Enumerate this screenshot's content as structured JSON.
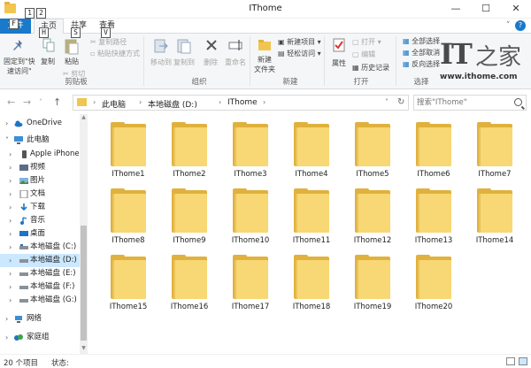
{
  "window": {
    "title": "IThome"
  },
  "keytips": [
    "F",
    "1",
    "2",
    "H",
    "S",
    "V"
  ],
  "tabs": {
    "file": "文件",
    "home": "主页",
    "share": "共享",
    "view": "查看"
  },
  "ribbon": {
    "clipboard": {
      "pin": "固定到\"快",
      "pin2": "速访问\"",
      "copy": "复制",
      "paste": "粘贴",
      "copy_path": "复制路径",
      "paste_shortcut": "粘贴快捷方式",
      "cut": "剪切",
      "label": "剪贴板"
    },
    "organize": {
      "move_to": "移动到",
      "copy_to": "复制到",
      "delete": "删除",
      "rename": "重命名",
      "label": "组织"
    },
    "new": {
      "new_folder": "新建",
      "new_folder2": "文件夹",
      "new_item": "新建项目 ▾",
      "easy_access": "轻松访问 ▾",
      "label": "新建"
    },
    "open": {
      "properties": "属性",
      "open": "打开 ▾",
      "edit": "编辑",
      "history": "历史记录",
      "label": "打开"
    },
    "select": {
      "select_all": "全部选择",
      "select_none": "全部取消",
      "invert": "反向选择",
      "label": "选择"
    }
  },
  "logo": {
    "text": "IT",
    "zh": "之家",
    "url": "www.ithome.com"
  },
  "address": {
    "crumbs": [
      "此电脑",
      "本地磁盘 (D:)",
      "IThome"
    ],
    "search_placeholder": "搜索\"IThome\""
  },
  "nav": {
    "items": [
      {
        "label": "OneDrive",
        "level": 0
      },
      {
        "label": "此电脑",
        "level": 0
      },
      {
        "label": "Apple iPhone",
        "level": 1
      },
      {
        "label": "视频",
        "level": 1
      },
      {
        "label": "图片",
        "level": 1
      },
      {
        "label": "文档",
        "level": 1
      },
      {
        "label": "下载",
        "level": 1
      },
      {
        "label": "音乐",
        "level": 1
      },
      {
        "label": "桌面",
        "level": 1
      },
      {
        "label": "本地磁盘 (C:)",
        "level": 1
      },
      {
        "label": "本地磁盘 (D:)",
        "level": 1,
        "selected": true
      },
      {
        "label": "本地磁盘 (E:)",
        "level": 1
      },
      {
        "label": "本地磁盘 (F:)",
        "level": 1
      },
      {
        "label": "本地磁盘 (G:)",
        "level": 1
      },
      {
        "label": "网络",
        "level": 0
      },
      {
        "label": "家庭组",
        "level": 0
      }
    ]
  },
  "folders": [
    "IThome1",
    "IThome2",
    "IThome3",
    "IThome4",
    "IThome5",
    "IThome6",
    "IThome7",
    "IThome8",
    "IThome9",
    "IThome10",
    "IThome11",
    "IThome12",
    "IThome13",
    "IThome14",
    "IThome15",
    "IThome16",
    "IThome17",
    "IThome18",
    "IThome19",
    "IThome20"
  ],
  "status": {
    "count": "20 个项目",
    "state": "状态:"
  },
  "colors": {
    "accent": "#1979ca",
    "folder": "#f8d775",
    "selection": "#cce8ff"
  }
}
